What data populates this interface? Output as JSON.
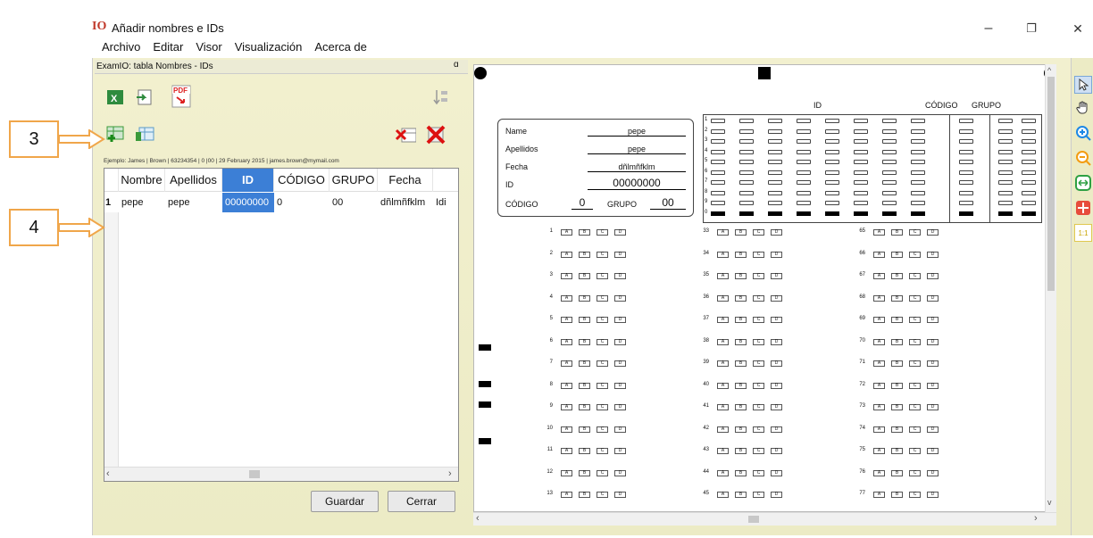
{
  "window": {
    "logo": "IO",
    "title": "Añadir nombres e IDs",
    "minimize": "–",
    "maximize": "❐",
    "close": "✕"
  },
  "menu": [
    "Archivo",
    "Editar",
    "Visor",
    "Visualización",
    "Acerca de"
  ],
  "panel": {
    "header": "ExamIO: tabla Nombres - IDs",
    "pin": "ɑ",
    "example": "Ejemplo: James | Brown | 63234354 | 0 |00 | 29 February 2015 | james.brown@mymail.com"
  },
  "callouts": {
    "three": "3",
    "four": "4"
  },
  "table": {
    "columns": [
      "Nombre",
      "Apellidos",
      "ID",
      "CÓDIGO",
      "GRUPO",
      "Fecha"
    ],
    "row_marker": "1",
    "row": [
      "pepe",
      "pepe",
      "00000000",
      "0",
      "00",
      "dñlmñfklm",
      "Idi"
    ]
  },
  "buttons": {
    "save": "Guardar",
    "close": "Cerrar"
  },
  "sheet": {
    "labels": {
      "name": "Name",
      "apellidos": "Apellidos",
      "fecha": "Fecha",
      "id": "ID",
      "codigo": "CÓDIGO",
      "grupo": "GRUPO"
    },
    "values": {
      "name": "pepe",
      "apellidos": "pepe",
      "fecha": "dñlmñfklm",
      "id": "00000000",
      "codigo": "0",
      "grupo": "00"
    },
    "grid_headers": {
      "id": "ID",
      "codigo": "CÓDIGO",
      "grupo": "GRUPO"
    },
    "grid_digits": [
      "1",
      "2",
      "3",
      "4",
      "5",
      "6",
      "7",
      "8",
      "9",
      "0"
    ],
    "answer_cols": [
      [
        "1",
        "2",
        "3",
        "4",
        "5",
        "6",
        "7",
        "8",
        "9",
        "10",
        "11",
        "12",
        "13"
      ],
      [
        "33",
        "34",
        "35",
        "36",
        "37",
        "38",
        "39",
        "40",
        "41",
        "42",
        "43",
        "44",
        "45"
      ],
      [
        "65",
        "66",
        "67",
        "68",
        "69",
        "70",
        "71",
        "72",
        "73",
        "74",
        "75",
        "76",
        "77"
      ]
    ],
    "choices": [
      "A",
      "B",
      "C",
      "D"
    ]
  },
  "colors": {
    "accent": "#f0a64a",
    "selected": "#3c7fd6",
    "panel": "#efeeca"
  }
}
